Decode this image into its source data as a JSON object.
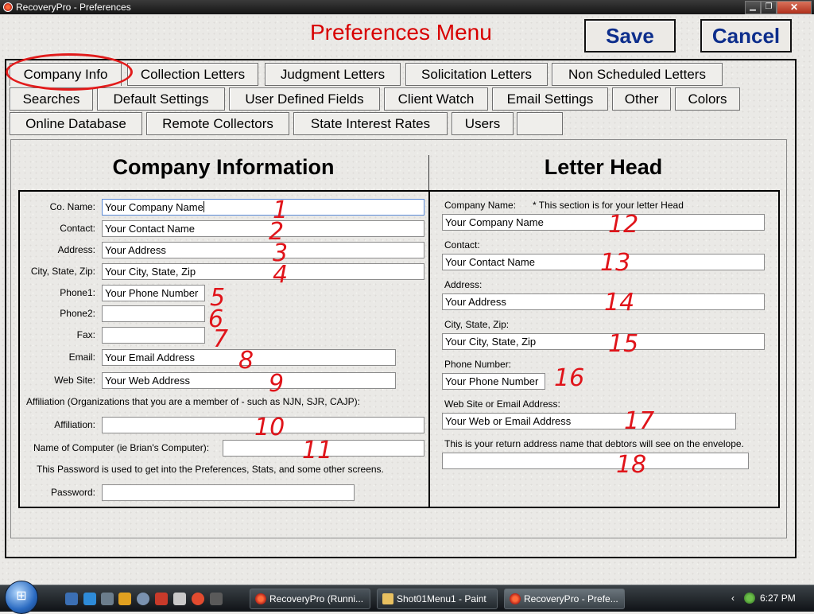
{
  "window": {
    "title": "RecoveryPro - Preferences",
    "buttons": {
      "minimize": "▁",
      "maximize": "❐",
      "close": "✕"
    }
  },
  "header": {
    "heading": "Preferences Menu",
    "save_label": "Save",
    "cancel_label": "Cancel"
  },
  "colors": {
    "heading": "#d80000",
    "button_text": "#0d2e8c",
    "annotation": "#e0141a"
  },
  "tabs": {
    "row1": [
      "Company Info",
      "Collection Letters",
      "Judgment Letters",
      "Solicitation Letters",
      "Non Scheduled Letters"
    ],
    "row2": [
      "Searches",
      "Default Settings",
      "User Defined Fields",
      "Client Watch",
      "Email Settings",
      "Other",
      "Colors"
    ],
    "row3": [
      "Online Database",
      "Remote Collectors",
      "State Interest Rates",
      "Users",
      ""
    ],
    "active": "Company Info"
  },
  "company": {
    "title": "Company Information",
    "co_name": {
      "label": "Co. Name:",
      "value": "Your Company Name"
    },
    "contact": {
      "label": "Contact:",
      "value": "Your Contact Name"
    },
    "address": {
      "label": "Address:",
      "value": "Your Address"
    },
    "city": {
      "label": "City, State, Zip:",
      "value": "Your City, State, Zip"
    },
    "phone1": {
      "label": "Phone1:",
      "value": "Your Phone Number"
    },
    "phone2": {
      "label": "Phone2:",
      "value": ""
    },
    "fax": {
      "label": "Fax:",
      "value": ""
    },
    "email": {
      "label": "Email:",
      "value": "Your Email Address"
    },
    "website": {
      "label": "Web Site:",
      "value": "Your Web Address"
    },
    "affiliation_note": "Affiliation (Organizations that you are a member of - such as NJN, SJR, CAJP):",
    "affiliation": {
      "label": "Affiliation:",
      "value": ""
    },
    "computer": {
      "label": "Name of Computer (ie Brian's Computer):",
      "value": ""
    },
    "password_note": "This Password is used to get into the Preferences, Stats, and some other screens.",
    "password": {
      "label": "Password:",
      "value": ""
    }
  },
  "letterhead": {
    "title": "Letter Head",
    "company_label": "Company Name:",
    "company_note": "* This section is for your letter Head",
    "company_value": "Your Company Name",
    "contact_label": "Contact:",
    "contact_value": "Your Contact Name",
    "address_label": "Address:",
    "address_value": "Your Address",
    "city_label": "City, State, Zip:",
    "city_value": "Your City, State, Zip",
    "phone_label": "Phone Number:",
    "phone_value": "Your Phone Number",
    "web_label": "Web Site or Email Address:",
    "web_value": "Your Web or Email Address",
    "return_note": "This is your return address name that debtors will see on the envelope.",
    "return_value": ""
  },
  "annotations": [
    "1",
    "2",
    "3",
    "4",
    "5",
    "6",
    "7",
    "8",
    "9",
    "10",
    "11",
    "12",
    "13",
    "14",
    "15",
    "16",
    "17",
    "18"
  ],
  "taskbar": {
    "tasks": [
      "RecoveryPro (Runni...",
      "Shot01Menu1 - Paint",
      "RecoveryPro - Prefe..."
    ],
    "clock": "6:27 PM",
    "tray_chevron": "‹"
  }
}
